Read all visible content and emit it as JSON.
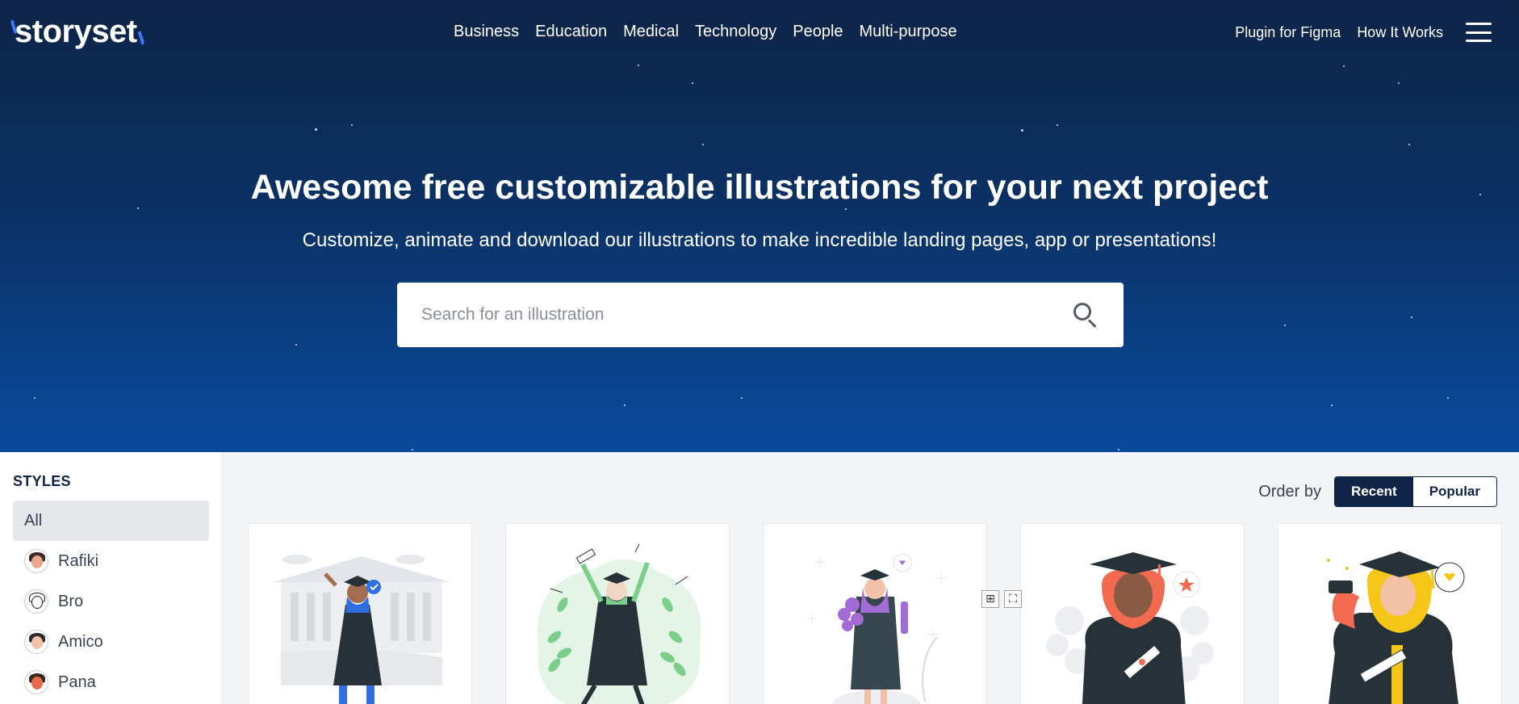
{
  "logo": {
    "text": "storyset"
  },
  "nav": {
    "items": [
      "Business",
      "Education",
      "Medical",
      "Technology",
      "People",
      "Multi-purpose"
    ]
  },
  "right_nav": {
    "items": [
      "Plugin for Figma",
      "How It Works"
    ]
  },
  "hero": {
    "title": "Awesome free customizable illustrations for your next project",
    "subtitle": "Customize, animate and download our illustrations to make incredible landing pages, app or presentations!"
  },
  "search": {
    "placeholder": "Search for an illustration"
  },
  "sidebar": {
    "title": "STYLES",
    "items": [
      {
        "label": "All",
        "active": true
      },
      {
        "label": "Rafiki",
        "avatar_color": "#3b2a28"
      },
      {
        "label": "Bro",
        "avatar_color": "#1a1a1a"
      },
      {
        "label": "Amico",
        "avatar_color": "#2b2b2b"
      },
      {
        "label": "Pana",
        "avatar_color": "#e86a4a"
      }
    ]
  },
  "order_by": {
    "label": "Order by",
    "options": [
      "Recent",
      "Popular"
    ],
    "selected": "Recent"
  },
  "cards": [
    {
      "name": "graduation-illustration-1",
      "accent": "#2f6fe0"
    },
    {
      "name": "graduation-illustration-2",
      "accent": "#7ccf8a"
    },
    {
      "name": "graduation-illustration-3",
      "accent": "#a36bd6"
    },
    {
      "name": "graduation-illustration-4",
      "accent": "#f26a4f"
    },
    {
      "name": "graduation-illustration-5",
      "accent": "#f5c518"
    }
  ],
  "colors": {
    "hero_top": "#0f2447",
    "hero_bottom": "#0a4a9c",
    "brand_dark": "#0f2447",
    "logo_accent": "#3a7bff"
  }
}
